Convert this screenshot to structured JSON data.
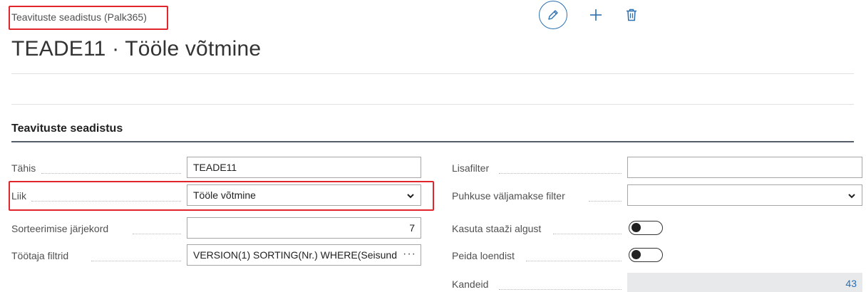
{
  "breadcrumb": "Teavituste seadistus (Palk365)",
  "page_title": "TEADE11 · Tööle võtmine",
  "icons": {
    "edit": "pencil-icon",
    "add": "plus-icon",
    "delete": "trash-icon"
  },
  "colors": {
    "accent": "#2b6fb0",
    "highlight": "#e0262c",
    "readonly_bg": "#e8e9ea"
  },
  "section": {
    "title": "Teavituste seadistus",
    "left_fields": [
      {
        "label": "Tähis",
        "value": "TEADE11",
        "type": "text"
      },
      {
        "label": "Liik",
        "value": "Tööle võtmine",
        "type": "select"
      },
      {
        "label": "Sorteerimise järjekord",
        "value": "7",
        "type": "number"
      },
      {
        "label": "Töötaja filtrid",
        "value": "VERSION(1) SORTING(Nr.) WHERE(Seisund",
        "type": "text-lookup"
      }
    ],
    "right_fields": [
      {
        "label": "Lisafilter",
        "value": "",
        "type": "text"
      },
      {
        "label": "Puhkuse väljamakse filter",
        "value": "",
        "type": "select"
      },
      {
        "label": "Kasuta staaži algust",
        "value": "off",
        "type": "toggle"
      },
      {
        "label": "Peida loendist",
        "value": "off",
        "type": "toggle"
      },
      {
        "label": "Kandeid",
        "value": "43",
        "type": "readonly"
      }
    ]
  }
}
